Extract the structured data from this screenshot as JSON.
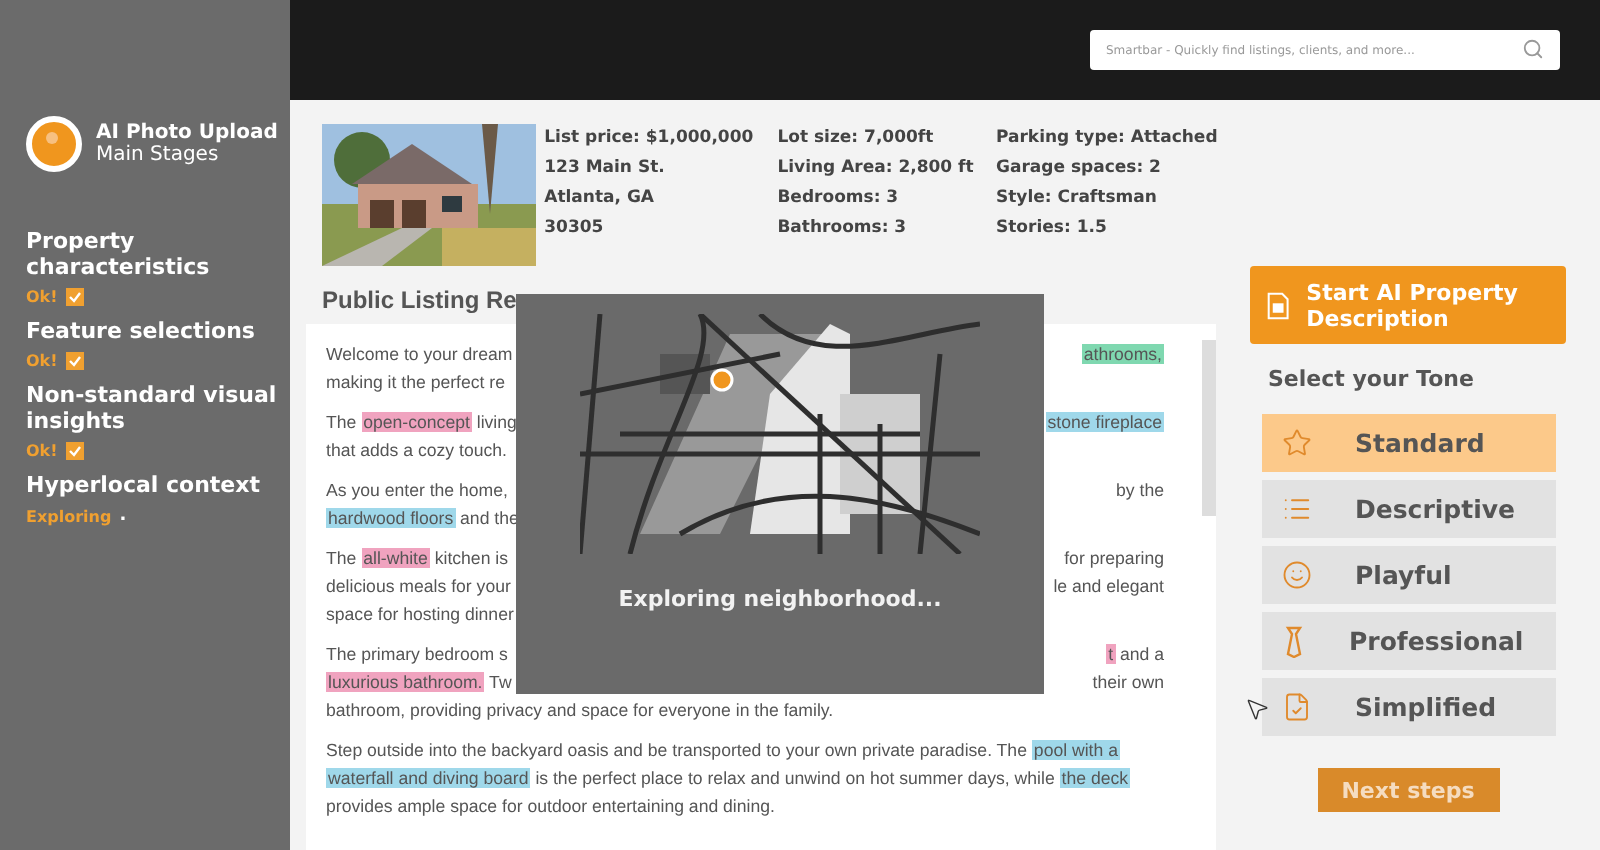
{
  "search": {
    "placeholder": "Smartbar - Quickly find listings, clients, and more..."
  },
  "sidebar": {
    "title": "AI Photo Upload",
    "subtitle": "Main Stages",
    "stages": [
      {
        "title": "Property characteristics",
        "status": "Ok!",
        "kind": "done",
        "checked": true
      },
      {
        "title": "Feature selections",
        "status": "Ok!",
        "kind": "done",
        "checked": true
      },
      {
        "title": "Non-standard visual insights",
        "status": "Ok!",
        "kind": "done",
        "checked": true
      },
      {
        "title": "Hyperlocal context",
        "status": "Exploring",
        "kind": "progress",
        "dots": "."
      }
    ]
  },
  "listing": {
    "photo": {
      "kind": "picture"
    },
    "facts": [
      [
        "List price: $1,000,000",
        "123 Main St.",
        "Atlanta, GA",
        "30305"
      ],
      [
        "Lot size: 7,000ft",
        "Living Area: 2,800 ft",
        "Bedrooms: 3",
        "Bathrooms: 3"
      ],
      [
        "Parking type: Attached",
        "Garage spaces: 2",
        "Style: Craftsman",
        "Stories: 1.5"
      ]
    ]
  },
  "remarks": {
    "heading": "Public Listing Re",
    "paragraphs": [
      [
        {
          "left": [
            {
              "text": "Welcome to your dream"
            }
          ],
          "right": [
            {
              "text": "athrooms,",
              "color": "#7fd8b0"
            }
          ]
        },
        {
          "left": [
            {
              "text": "making it the perfect re"
            }
          ]
        }
      ],
      [
        {
          "left": [
            {
              "text": "The "
            },
            {
              "text": "open-concept",
              "color": "#f0a3bf"
            },
            {
              "text": " living"
            }
          ],
          "right": [
            {
              "text": "stone fireplace",
              "color": "#9fd8ea"
            }
          ]
        },
        {
          "left": [
            {
              "text": "that adds a cozy touch."
            }
          ]
        }
      ],
      [
        {
          "left": [
            {
              "text": "As you enter the home,"
            }
          ],
          "right": [
            {
              "text": "by the"
            }
          ]
        },
        {
          "left": [
            {
              "text": "hardwood floors",
              "color": "#9fd8ea"
            },
            {
              "text": " and the"
            }
          ]
        }
      ],
      [
        {
          "left": [
            {
              "text": "The "
            },
            {
              "text": "all-white",
              "color": "#f0a3bf"
            },
            {
              "text": " kitchen is"
            }
          ],
          "right": [
            {
              "text": "for preparing"
            }
          ]
        },
        {
          "left": [
            {
              "text": "delicious meals for your"
            }
          ],
          "right": [
            {
              "text": "le and elegant"
            }
          ]
        },
        {
          "left": [
            {
              "text": "space for hosting dinner"
            }
          ]
        }
      ],
      [
        {
          "left": [
            {
              "text": "The primary bedroom s"
            }
          ],
          "right": [
            {
              "text": "t",
              "color": "#f0a3bf"
            },
            {
              "text": " and a"
            }
          ]
        },
        {
          "left": [
            {
              "text": "luxurious bathroom.",
              "color": "#f0a3bf"
            },
            {
              "text": " Tw"
            }
          ],
          "right": [
            {
              "text": "their own"
            }
          ]
        },
        {
          "left": [
            {
              "text": "bathroom, providing privacy and space for everyone in the family."
            }
          ]
        }
      ],
      [
        {
          "left": [
            {
              "text": "Step outside into the backyard oasis and be transported to your own private paradise. The "
            },
            {
              "text": "pool with a",
              "color": "#9fd8ea"
            }
          ]
        },
        {
          "left": [
            {
              "text": "waterfall and diving board",
              "color": "#9fd8ea"
            },
            {
              "text": " is the perfect place to relax and unwind on hot summer days, while "
            },
            {
              "text": "the deck",
              "color": "#9fd8ea"
            }
          ]
        },
        {
          "left": [
            {
              "text": "provides ample space for outdoor entertaining and dining."
            }
          ]
        }
      ]
    ]
  },
  "modal": {
    "message": "Exploring neighborhood..."
  },
  "tone_panel": {
    "start_button": "Start AI Property Description",
    "heading": "Select your Tone",
    "tones": [
      {
        "label": "Standard",
        "kind": "star",
        "selected": true
      },
      {
        "label": "Descriptive",
        "kind": "list",
        "selected": false
      },
      {
        "label": "Playful",
        "kind": "smile",
        "selected": false
      },
      {
        "label": "Professional",
        "kind": "tie",
        "selected": false
      },
      {
        "label": "Simplified",
        "kind": "doc",
        "selected": false
      }
    ],
    "next_button": "Next steps"
  }
}
